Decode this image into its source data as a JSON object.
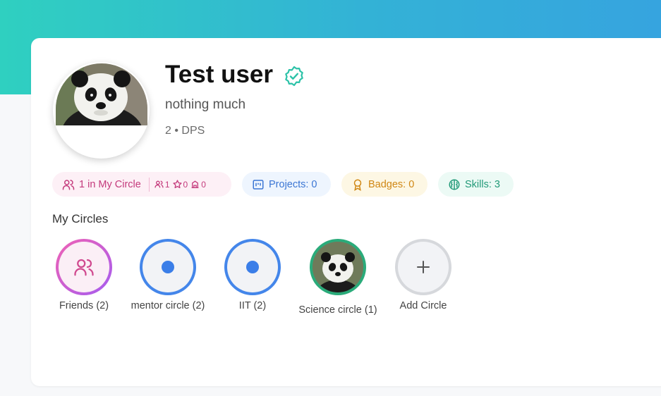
{
  "profile": {
    "name": "Test user",
    "bio": "nothing much",
    "meta": "2 • DPS"
  },
  "stats": {
    "circle_label": "1 in My Circle",
    "mini_members": "1",
    "mini_stars": "0",
    "mini_orgs": "0",
    "projects_label": "Projects: 0",
    "badges_label": "Badges: 0",
    "skills_label": "Skills: 3"
  },
  "circles": {
    "title": "My Circles",
    "items": [
      {
        "label": "Friends (2)"
      },
      {
        "label": "mentor circle (2)"
      },
      {
        "label": "IIT (2)"
      },
      {
        "label": "Science circle (1)"
      },
      {
        "label": "Add Circle"
      }
    ]
  },
  "colors": {
    "banner_start": "#2fd0c0",
    "banner_end": "#36a4df",
    "verified": "#2cc2a8",
    "circle_pink": "#c43a7c",
    "projects_blue": "#3b76d4",
    "badges_orange": "#d08714",
    "skills_green": "#219a78"
  },
  "icons": [
    "verified-badge-icon",
    "users-icon",
    "star-icon",
    "building-icon",
    "projects-icon",
    "badge-icon",
    "brain-icon",
    "plus-icon"
  ]
}
